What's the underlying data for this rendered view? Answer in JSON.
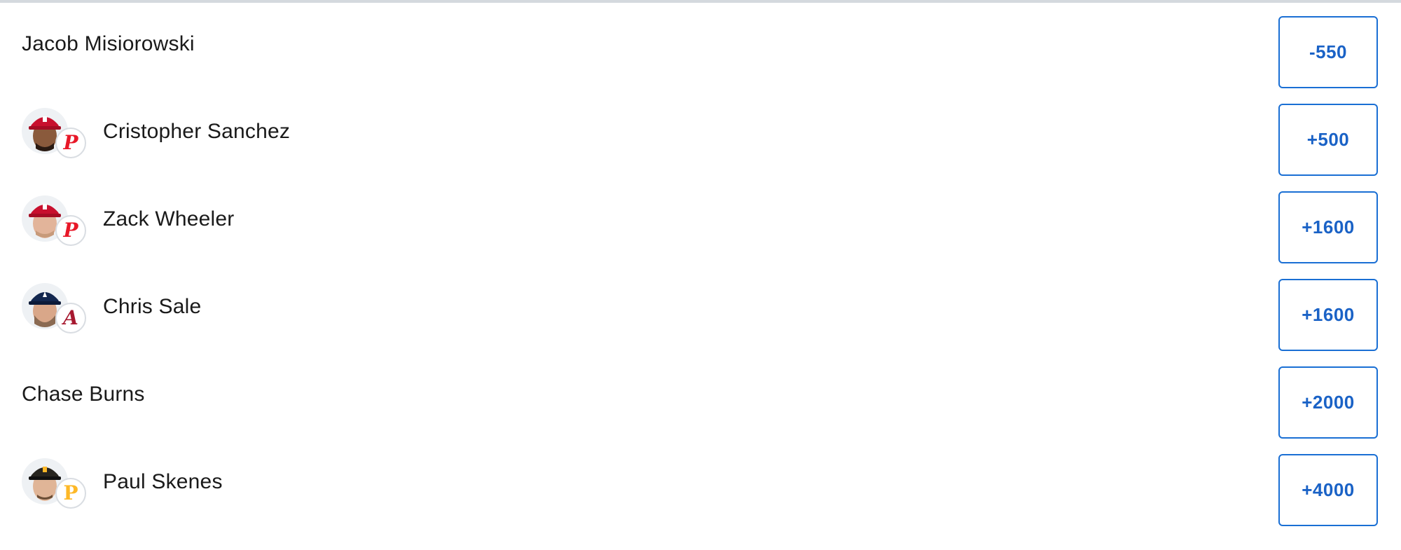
{
  "outcomes": [
    {
      "player": "Jacob Misiorowski",
      "odds": "-550",
      "has_headshot": false
    },
    {
      "player": "Cristopher Sanchez",
      "odds": "+500",
      "has_headshot": true,
      "team_logo": "P",
      "logo_color": "#e81828",
      "cap_color": "#c8102e",
      "logo_icon": "phillies-logo-icon"
    },
    {
      "player": "Zack Wheeler",
      "odds": "+1600",
      "has_headshot": true,
      "team_logo": "P",
      "logo_color": "#e81828",
      "cap_color": "#c8102e",
      "logo_icon": "phillies-logo-icon"
    },
    {
      "player": "Chris Sale",
      "odds": "+1600",
      "has_headshot": true,
      "team_logo": "A",
      "logo_color": "#a71930",
      "cap_color": "#13274f",
      "logo_icon": "braves-logo-icon"
    },
    {
      "player": "Chase Burns",
      "odds": "+2000",
      "has_headshot": false
    },
    {
      "player": "Paul Skenes",
      "odds": "+4000",
      "has_headshot": true,
      "team_logo": "P",
      "logo_color": "#fdb827",
      "cap_color": "#27251f",
      "logo_icon": "pirates-logo-icon"
    }
  ],
  "colors": {
    "accent": "#1a6fd4",
    "odds_text": "#1a62c6",
    "name_text": "#1a1a1a",
    "divider": "#d4d9de"
  }
}
